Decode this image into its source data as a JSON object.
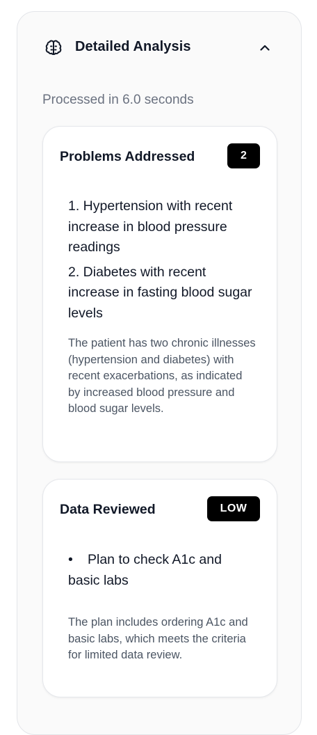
{
  "header": {
    "title": "Detailed Analysis",
    "icon": "brain-icon",
    "collapse_icon": "chevron-up-icon"
  },
  "processed_text": "Processed in 6.0 seconds",
  "problems": {
    "title": "Problems Addressed",
    "badge": "2",
    "items": [
      "1. Hypertension with recent increase in blood pressure readings",
      "2. Diabetes with recent increase in fasting blood sugar levels"
    ],
    "note": "The patient has two chronic illnesses (hypertension and diabetes) with recent exacerbations, as indicated by increased blood pressure and blood sugar levels."
  },
  "data_reviewed": {
    "title": "Data Reviewed",
    "badge": "LOW",
    "bullet": "•",
    "items": [
      "Plan to check A1c and basic labs"
    ],
    "note": "The plan includes ordering A1c and basic labs, which meets the criteria for limited data review."
  },
  "colors": {
    "badge_bg": "#000000",
    "muted_text": "#6b7280",
    "card_border": "#e5e7eb"
  }
}
